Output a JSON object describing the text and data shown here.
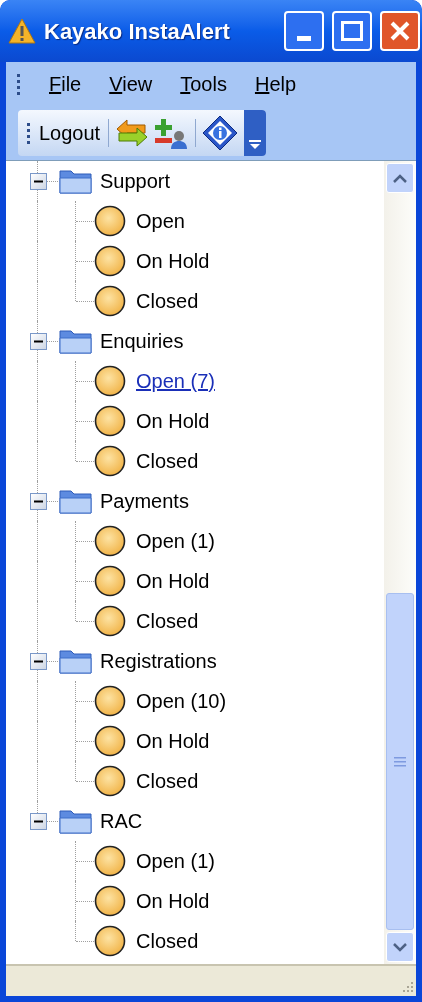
{
  "window": {
    "title": "Kayako InstaAlert"
  },
  "menu": [
    "File",
    "View",
    "Tools",
    "Help"
  ],
  "toolbar": {
    "button": "Logout"
  },
  "tree": [
    {
      "label": "Support",
      "expanded": true,
      "children": [
        {
          "label": "Open",
          "hovered": false
        },
        {
          "label": "On Hold",
          "hovered": false
        },
        {
          "label": "Closed",
          "hovered": false
        }
      ]
    },
    {
      "label": "Enquiries",
      "expanded": true,
      "children": [
        {
          "label": "Open (7)",
          "hovered": true
        },
        {
          "label": "On Hold",
          "hovered": false
        },
        {
          "label": "Closed",
          "hovered": false
        }
      ]
    },
    {
      "label": "Payments",
      "expanded": true,
      "children": [
        {
          "label": "Open (1)",
          "hovered": false
        },
        {
          "label": "On Hold",
          "hovered": false
        },
        {
          "label": "Closed",
          "hovered": false
        }
      ]
    },
    {
      "label": "Registrations",
      "expanded": true,
      "children": [
        {
          "label": "Open (10)",
          "hovered": false
        },
        {
          "label": "On Hold",
          "hovered": false
        },
        {
          "label": "Closed",
          "hovered": false
        }
      ]
    },
    {
      "label": "RAC",
      "expanded": true,
      "children": [
        {
          "label": "Open (1)",
          "hovered": false
        },
        {
          "label": "On Hold",
          "hovered": false
        },
        {
          "label": "Closed",
          "hovered": false
        }
      ]
    }
  ]
}
